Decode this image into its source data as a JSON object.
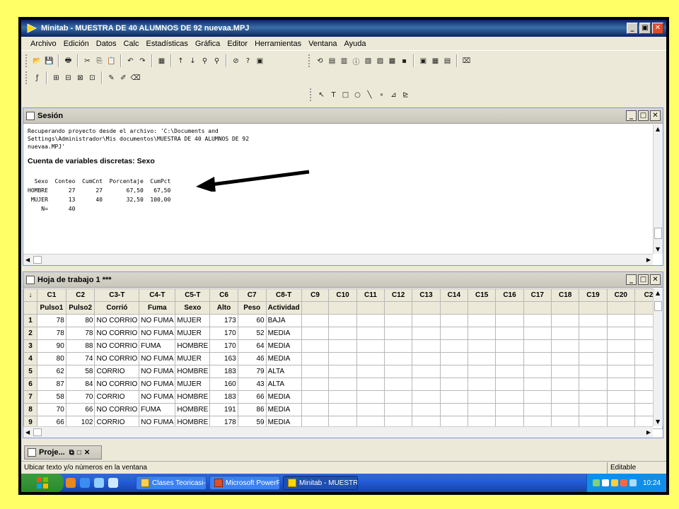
{
  "window": {
    "title": "Minitab - MUESTRA DE 40 ALUMNOS DE 92 nuevaa.MPJ",
    "min": "_",
    "restore": "▣",
    "close": "✕"
  },
  "menu": [
    "Archivo",
    "Edición",
    "Datos",
    "Calc",
    "Estadísticas",
    "Gráfica",
    "Editor",
    "Herramientas",
    "Ventana",
    "Ayuda"
  ],
  "session": {
    "title": "Sesión",
    "text_lines": [
      "Recuperando proyecto desde el archivo: 'C:\\Documents and",
      "Settings\\Administrador\\Mis documentos\\MUESTRA DE 40 ALUMNOS DE 92",
      "nuevaa.MPJ'"
    ],
    "heading": "Cuenta de variables discretas: Sexo",
    "table_header": "  Sexo  Conteo  CumCnt  Porcentaje  CumPct",
    "table_rows": [
      "HOMBRE      27      27       67,50   67,50",
      " MUJER      13      40       32,50  100,00",
      "    N=      40"
    ]
  },
  "worksheet": {
    "title": "Hoja de trabajo 1 ***",
    "corner": "↓",
    "column_ids": [
      "C1",
      "C2",
      "C3-T",
      "C4-T",
      "C5-T",
      "C6",
      "C7",
      "C8-T",
      "C9",
      "C10",
      "C11",
      "C12",
      "C13",
      "C14",
      "C15",
      "C16",
      "C17",
      "C18",
      "C19",
      "C20",
      "C2"
    ],
    "column_names": [
      "Pulso1",
      "Pulso2",
      "Corrió",
      "Fuma",
      "Sexo",
      "Alto",
      "Peso",
      "Actividad",
      "",
      "",
      "",
      "",
      "",
      "",
      "",
      "",
      "",
      "",
      "",
      "",
      ""
    ],
    "rows": [
      [
        "1",
        "78",
        "80",
        "NO CORRIO",
        "NO FUMA",
        "MUJER",
        "173",
        "60",
        "BAJA"
      ],
      [
        "2",
        "78",
        "78",
        "NO CORRIO",
        "NO FUMA",
        "MUJER",
        "170",
        "52",
        "MEDIA"
      ],
      [
        "3",
        "90",
        "88",
        "NO CORRIO",
        "FUMA",
        "HOMBRE",
        "170",
        "64",
        "MEDIA"
      ],
      [
        "4",
        "80",
        "74",
        "NO CORRIO",
        "NO FUMA",
        "MUJER",
        "163",
        "46",
        "MEDIA"
      ],
      [
        "5",
        "62",
        "58",
        "CORRIO",
        "NO FUMA",
        "HOMBRE",
        "183",
        "79",
        "ALTA"
      ],
      [
        "6",
        "87",
        "84",
        "NO CORRIO",
        "NO FUMA",
        "MUJER",
        "160",
        "43",
        "ALTA"
      ],
      [
        "7",
        "58",
        "70",
        "CORRIO",
        "NO FUMA",
        "HOMBRE",
        "183",
        "66",
        "MEDIA"
      ],
      [
        "8",
        "70",
        "66",
        "NO CORRIO",
        "FUMA",
        "HOMBRE",
        "191",
        "86",
        "MEDIA"
      ],
      [
        "9",
        "66",
        "102",
        "CORRIO",
        "NO FUMA",
        "HOMBRE",
        "178",
        "59",
        "MEDIA"
      ]
    ]
  },
  "project_window": {
    "title": "Proje..."
  },
  "status": {
    "message": "Ubicar texto y/o números en la ventana",
    "mode": "Editable"
  },
  "taskbar": {
    "tasks": [
      "Clases Teoricasi-...",
      "Microsoft PowerP...",
      "Minitab - MUESTR..."
    ],
    "clock": "10:24"
  },
  "colors": {
    "titlebar": "#0a246a",
    "highlight_bg": "#ffff66",
    "taskbar": "#245edb"
  }
}
